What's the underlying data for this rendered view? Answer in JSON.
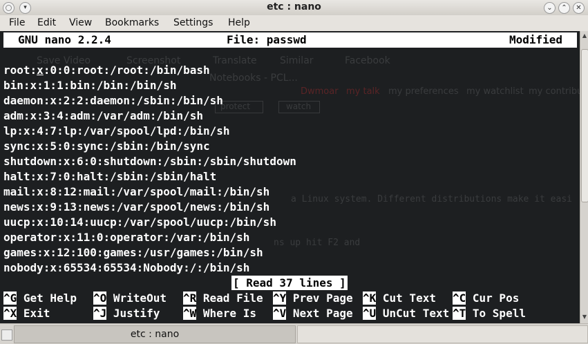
{
  "window": {
    "title": "etc : nano",
    "menu_glyph": "▾",
    "buttons": {
      "minimize": "⌄",
      "maximize": "⌃",
      "close": "✕"
    }
  },
  "menubar": [
    "File",
    "Edit",
    "View",
    "Bookmarks",
    "Settings",
    "Help"
  ],
  "nano": {
    "version": "GNU nano 2.2.4",
    "file": "File: passwd",
    "state": "Modified",
    "lines": [
      "root:x:0:0:root:/root:/bin/bash",
      "bin:x:1:1:bin:/bin:/bin/sh",
      "daemon:x:2:2:daemon:/sbin:/bin/sh",
      "adm:x:3:4:adm:/var/adm:/bin/sh",
      "lp:x:4:7:lp:/var/spool/lpd:/bin/sh",
      "sync:x:5:0:sync:/sbin:/bin/sync",
      "shutdown:x:6:0:shutdown:/sbin:/sbin/shutdown",
      "halt:x:7:0:halt:/sbin:/sbin/halt",
      "mail:x:8:12:mail:/var/spool/mail:/bin/sh",
      "news:x:9:13:news:/var/spool/news:/bin/sh",
      "uucp:x:10:14:uucp:/var/spool/uucp:/bin/sh",
      "operator:x:11:0:operator:/var:/bin/sh",
      "games:x:12:100:games:/usr/games:/bin/sh",
      "nobody:x:65534:65534:Nobody:/:/bin/sh"
    ],
    "status": "[ Read 37 lines ]",
    "shortcuts_row1": [
      {
        "key": "^G",
        "label": " Get Help"
      },
      {
        "key": "^O",
        "label": " WriteOut"
      },
      {
        "key": "^R",
        "label": " Read File"
      },
      {
        "key": "^Y",
        "label": " Prev Page"
      },
      {
        "key": "^K",
        "label": " Cut Text"
      },
      {
        "key": "^C",
        "label": " Cur Pos"
      }
    ],
    "shortcuts_row2": [
      {
        "key": "^X",
        "label": " Exit"
      },
      {
        "key": "^J",
        "label": " Justify"
      },
      {
        "key": "^W",
        "label": " Where Is"
      },
      {
        "key": "^V",
        "label": " Next Page"
      },
      {
        "key": "^U",
        "label": " UnCut Text"
      },
      {
        "key": "^T",
        "label": " To Spell"
      }
    ]
  },
  "background_ghost": {
    "save_video": "Save Video",
    "screenshot": "Screenshot",
    "translate": "Translate",
    "similar": "Similar",
    "facebook": "Facebook",
    "tab": "Notebooks - PCL...",
    "user": "Dwmoar",
    "my_talk": "my talk",
    "my_preferences": "my preferences",
    "my_watchlist": "my watchlist",
    "my_contrib": "my contribu",
    "protect": "protect",
    "watch": "watch",
    "text1": "a Linux system. Different distributions make it easi",
    "text2": "ns up hit F2 and"
  },
  "taskbar": {
    "task": "etc : nano"
  }
}
